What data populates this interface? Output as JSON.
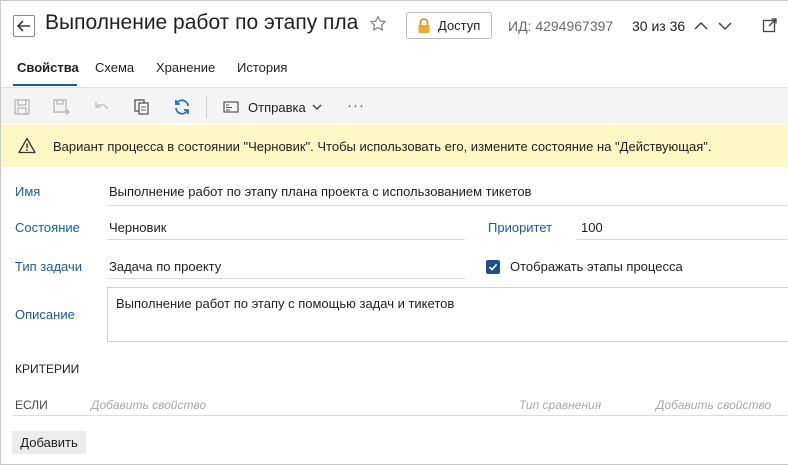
{
  "header": {
    "title": "Выполнение работ по этапу пла...",
    "access_label": "Доступ",
    "id_text": "ИД: 4294967397",
    "record_counter": "30 из 36"
  },
  "tabs": [
    {
      "label": "Свойства",
      "active": true
    },
    {
      "label": "Схема",
      "active": false
    },
    {
      "label": "Хранение",
      "active": false
    },
    {
      "label": "История",
      "active": false
    }
  ],
  "toolbar": {
    "send_label": "Отправка",
    "more_label": "···"
  },
  "banner": {
    "message": "Вариант процесса в состоянии \"Черновик\". Чтобы использовать его, измените состояние на \"Действующая\"."
  },
  "form": {
    "name_label": "Имя",
    "name_value": "Выполнение работ по этапу плана проекта с использованием тикетов",
    "state_label": "Состояние",
    "state_value": "Черновик",
    "priority_label": "Приоритет",
    "priority_value": "100",
    "task_type_label": "Тип задачи",
    "task_type_value": "Задача по проекту",
    "show_stages_label": "Отображать этапы процесса",
    "show_stages_checked": true,
    "description_label": "Описание",
    "description_value": "Выполнение работ по этапу с помощью задач и тикетов"
  },
  "criteria": {
    "section_title": "КРИТЕРИИ",
    "if_label": "ЕСЛИ",
    "add_property_placeholder": "Добавить свойство",
    "comparison_type_placeholder": "Тип сравнения",
    "add_property_placeholder_2": "Добавить свойство",
    "add_button": "Добавить"
  },
  "colors": {
    "accent": "#1a5aa6",
    "banner_bg": "#fdf7c4",
    "toolbar_bg": "#f4f4f4",
    "refresh_icon": "#1f6fc0"
  }
}
